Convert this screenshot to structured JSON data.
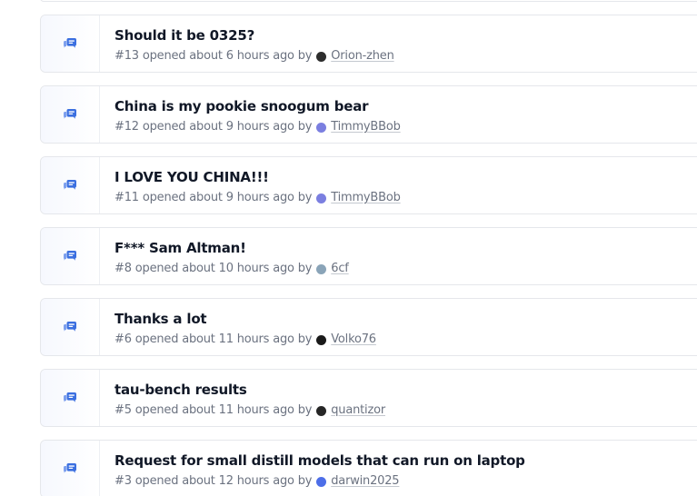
{
  "discussions": [
    {
      "title": "Should it be 0325?",
      "number": "#13",
      "opened": "opened about 6 hours ago by",
      "author": "Orion-zhen",
      "avatar_color": "#2d2d2d"
    },
    {
      "title": "China is my pookie snoogum bear",
      "number": "#12",
      "opened": "opened about 9 hours ago by",
      "author": "TimmyBBob",
      "avatar_color": "#7b7fe0"
    },
    {
      "title": "I LOVE YOU CHINA!!!",
      "number": "#11",
      "opened": "opened about 9 hours ago by",
      "author": "TimmyBBob",
      "avatar_color": "#7b7fe0"
    },
    {
      "title": "F*** Sam Altman!",
      "number": "#8",
      "opened": "opened about 10 hours ago by",
      "author": "6cf",
      "avatar_color": "#8aa4b8"
    },
    {
      "title": "Thanks a lot",
      "number": "#6",
      "opened": "opened about 11 hours ago by",
      "author": "Volko76",
      "avatar_color": "#1a1a1a"
    },
    {
      "title": "tau-bench results",
      "number": "#5",
      "opened": "opened about 11 hours ago by",
      "author": "quantizor",
      "avatar_color": "#262626"
    },
    {
      "title": "Request for small distill models that can run on laptop",
      "number": "#3",
      "opened": "opened about 12 hours ago by",
      "author": "darwin2025",
      "avatar_color": "#4d6ee8"
    }
  ],
  "icon": "discussion-bubble-icon",
  "colors": {
    "accent": "#3b6fe0",
    "title": "#111827",
    "meta": "#6b7280",
    "border": "#e5e7eb"
  }
}
